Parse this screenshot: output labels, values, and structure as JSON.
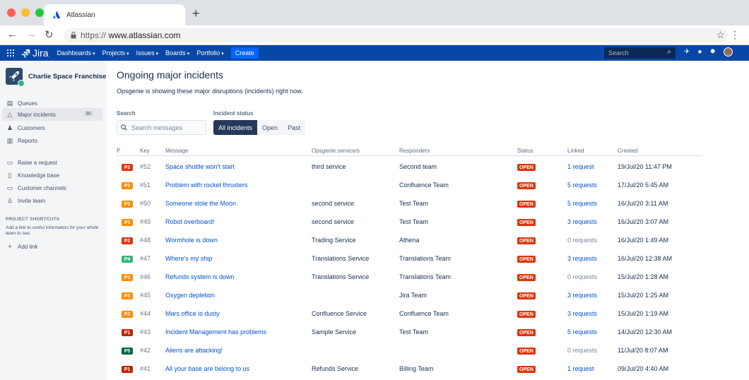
{
  "browser": {
    "tab_title": "Atlassian",
    "new_tab": "+",
    "url_proto": "https://",
    "url_host": "www.atlassian.com",
    "dot_colors": [
      "#FF5F57",
      "#FEBC2E",
      "#28C840"
    ]
  },
  "header": {
    "logo": "Jira",
    "menus": [
      "Dashboards",
      "Projects",
      "Issues",
      "Boards",
      "Portfolio"
    ],
    "create": "Create",
    "search_placeholder": "Search"
  },
  "sidebar": {
    "project": "Charlie Space Franchise",
    "items": [
      {
        "label": "Queues",
        "icon": "queues-icon"
      },
      {
        "label": "Major incidents",
        "icon": "warning-icon",
        "count": "90",
        "active": true
      },
      {
        "label": "Customers",
        "icon": "people-icon"
      },
      {
        "label": "Reports",
        "icon": "reports-icon"
      },
      {
        "label": "Raise a request",
        "icon": "request-icon"
      },
      {
        "label": "Knowledge base",
        "icon": "page-icon"
      },
      {
        "label": "Customer channels",
        "icon": "monitor-icon"
      },
      {
        "label": "Invite team",
        "icon": "person-add-icon"
      }
    ],
    "shortcuts_heading": "PROJECT SHORTCUTS",
    "shortcuts_text": "Add a link to useful information for your whole team to see.",
    "add_link": "Add link"
  },
  "main": {
    "title": "Ongoing major incidents",
    "subtitle": "Opsgenie is showing these major disruptions (incidents) right now.",
    "search_label": "Search",
    "search_placeholder": "Search messages",
    "status_label": "Incident status",
    "status_options": [
      "All incidents",
      "Open",
      "Past"
    ],
    "columns": [
      "P",
      "Key",
      "Message",
      "Opsgenie service/s",
      "Responders",
      "Status",
      "Linked",
      "Created"
    ],
    "rows": [
      {
        "p": "P2",
        "key": "#52",
        "message": "Space shuttle won't start",
        "service": "third service",
        "responders": "Second team",
        "status": "OPEN",
        "linked": "1 request",
        "created": "19/Jul/20 11:47 PM"
      },
      {
        "p": "P3",
        "key": "#51",
        "message": "Problem with rocket thrusters",
        "service": "",
        "responders": "Confluence Team",
        "status": "OPEN",
        "linked": "5 requests",
        "created": "17/Jul/20 5:45 AM"
      },
      {
        "p": "P3",
        "key": "#50",
        "message": "Someone stole the Moon",
        "service": "second service",
        "responders": "Test Team",
        "status": "OPEN",
        "linked": "5 requests",
        "created": "16/Jul/20 3:11 AM"
      },
      {
        "p": "P3",
        "key": "#49",
        "message": "Robot overboard!",
        "service": "second service",
        "responders": "Test Team",
        "status": "OPEN",
        "linked": "3 requests",
        "created": "16/Jul/20 3:07 AM"
      },
      {
        "p": "P2",
        "key": "#48",
        "message": "Wormhole is down",
        "service": "Trading Service",
        "responders": "Athena",
        "status": "OPEN",
        "linked": "0 requests",
        "created": "16/Jul/20 1:49 AM"
      },
      {
        "p": "P4",
        "key": "#47",
        "message": "Where's my ship",
        "service": "Translations Service",
        "responders": "Translations Team",
        "status": "OPEN",
        "linked": "3 requests",
        "created": "16/Jul/20 12:38 AM"
      },
      {
        "p": "P3",
        "key": "#46",
        "message": "Refunds system is down",
        "service": "Translations Service",
        "responders": "Translations Team",
        "status": "OPEN",
        "linked": "0 requests",
        "created": "15/Jul/20 1:28 AM"
      },
      {
        "p": "P3",
        "key": "#45",
        "message": "Oxygen depletion",
        "service": "",
        "responders": "Jira Team",
        "status": "OPEN",
        "linked": "3 requests",
        "created": "15/Jul/20 1:25 AM"
      },
      {
        "p": "P3",
        "key": "#44",
        "message": "Mars office is dusty",
        "service": "Confluence Service",
        "responders": "Confluence Team",
        "status": "OPEN",
        "linked": "3 requests",
        "created": "15/Jul/20 1:19 AM"
      },
      {
        "p": "P1",
        "key": "#43",
        "message": "Incident Management has problems",
        "service": "Sample Service",
        "responders": "Test Team",
        "status": "OPEN",
        "linked": "5 requests",
        "created": "14/Jul/20 12:30 AM"
      },
      {
        "p": "P5",
        "key": "#42",
        "message": "Aliens are attacking!",
        "service": "",
        "responders": "",
        "status": "OPEN",
        "linked": "0 requests",
        "created": "11/Jul/20 8:07 AM"
      },
      {
        "p": "P1",
        "key": "#41",
        "message": "All your base are belong to us",
        "service": "Refunds Service",
        "responders": "Billing Team",
        "status": "OPEN",
        "linked": "1 request",
        "created": "09/Jul/20 4:40 AM"
      }
    ],
    "priority_colors": {
      "P1": "#BF2600",
      "P2": "#DE350B",
      "P3": "#FF8B00",
      "P4": "#36B37E",
      "P5": "#006644"
    }
  }
}
